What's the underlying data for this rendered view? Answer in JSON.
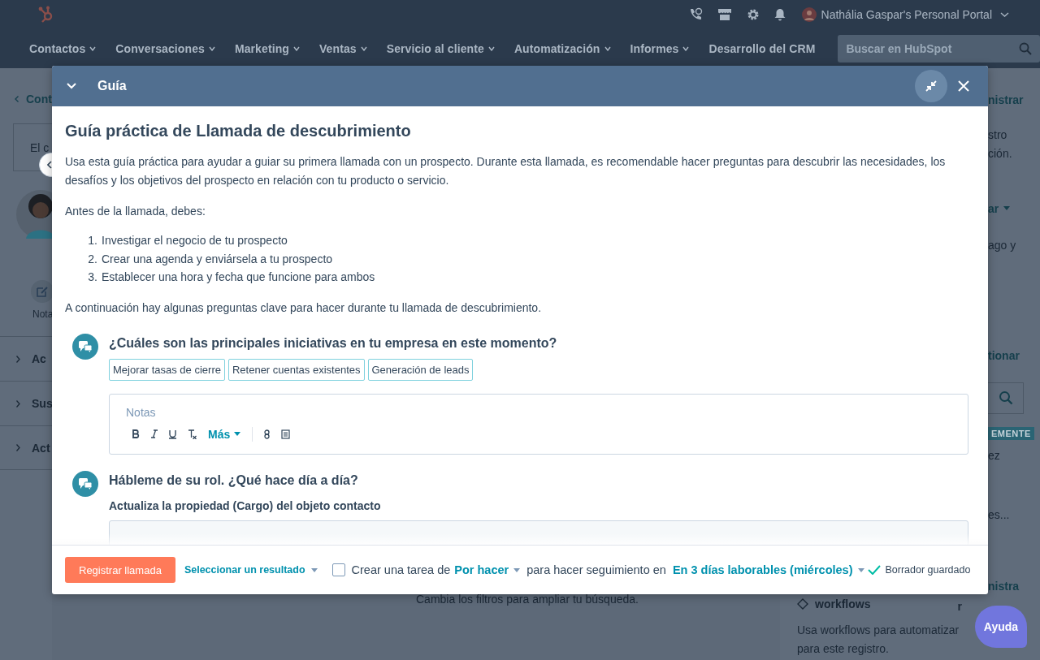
{
  "top_bar": {
    "portal_name": "Nathália Gaspar's Personal Portal"
  },
  "nav": {
    "items": [
      {
        "label": "Contactos",
        "dropdown": true
      },
      {
        "label": "Conversaciones",
        "dropdown": true
      },
      {
        "label": "Marketing",
        "dropdown": true
      },
      {
        "label": "Ventas",
        "dropdown": true
      },
      {
        "label": "Servicio al cliente",
        "dropdown": true
      },
      {
        "label": "Automatización",
        "dropdown": true
      },
      {
        "label": "Informes",
        "dropdown": true
      },
      {
        "label": "Desarrollo del CRM",
        "dropdown": false
      }
    ],
    "search": {
      "placeholder": "Buscar en HubSpot"
    }
  },
  "left_panel": {
    "back_link": "Cont",
    "summary_box": "El c",
    "note_action": "Nota",
    "sections": [
      "Ac",
      "Sus",
      "Act"
    ]
  },
  "center_panel": {
    "empty_hint": "Cambia los filtros para ampliar tu búsqueda."
  },
  "right_panel": {
    "fragments": [
      {
        "kind": "link",
        "text": "nistrar"
      },
      {
        "kind": "text",
        "text": "stro"
      },
      {
        "kind": "text",
        "text": "ción."
      },
      {
        "kind": "dropdown",
        "text": "ar"
      },
      {
        "kind": "text",
        "text": "ago y"
      },
      {
        "kind": "link",
        "text": "tionar"
      },
      {
        "kind": "search"
      },
      {
        "kind": "badge",
        "text": "EMENTE"
      },
      {
        "kind": "text",
        "text": "ez"
      },
      {
        "kind": "text",
        "text": "es..."
      },
      {
        "kind": "link",
        "text": "nistra"
      }
    ],
    "card": {
      "title": "workflows",
      "side": "r",
      "lines": [
        "Usa workflows para automatizar",
        "para este registro."
      ]
    }
  },
  "guide": {
    "title": "Guía",
    "heading": "Guía práctica de Llamada de descubrimiento",
    "intro": "Usa esta guía práctica para ayudar a guiar su primera llamada con un prospecto. Durante esta llamada, es recomendable hacer preguntas para descubrir las necesidades, los desafíos y los objetivos del prospecto en relación con tu producto o servicio.",
    "before": "Antes de la llamada, debes:",
    "steps": [
      {
        "number": "1.",
        "text": "Investigar el negocio de tu prospecto"
      },
      {
        "number": "2.",
        "text": "Crear una agenda y enviársela a tu prospecto"
      },
      {
        "number": "3.",
        "text": "Establecer una hora y fecha que funcione para ambos"
      }
    ],
    "after": "A continuación hay algunas preguntas clave para hacer durante tu llamada de descubrimiento.",
    "questions": [
      {
        "kind": "notes",
        "question": "¿Cuáles son las principales iniciativas en tu empresa en este momento?",
        "chips": [
          "Mejorar tasas de cierre",
          "Retener cuentas existentes",
          "Generación de leads"
        ],
        "placeholder": "Notas",
        "more": "Más"
      },
      {
        "kind": "property",
        "question": "Hábleme de su rol. ¿Qué hace día a día?",
        "subtitle": "Actualiza la propiedad (Cargo) del objeto contacto"
      }
    ],
    "footer": {
      "register": "Registrar llamada",
      "outcome": "Seleccionar un resultado",
      "task_checked": false,
      "task_prefix": "Crear una tarea de",
      "task_type": "Por hacer",
      "task_middle": "para hacer seguimiento en",
      "due": "En 3 días laborables (miércoles)",
      "saved": "Borrador guardado"
    }
  },
  "help": {
    "label": "Ayuda"
  }
}
